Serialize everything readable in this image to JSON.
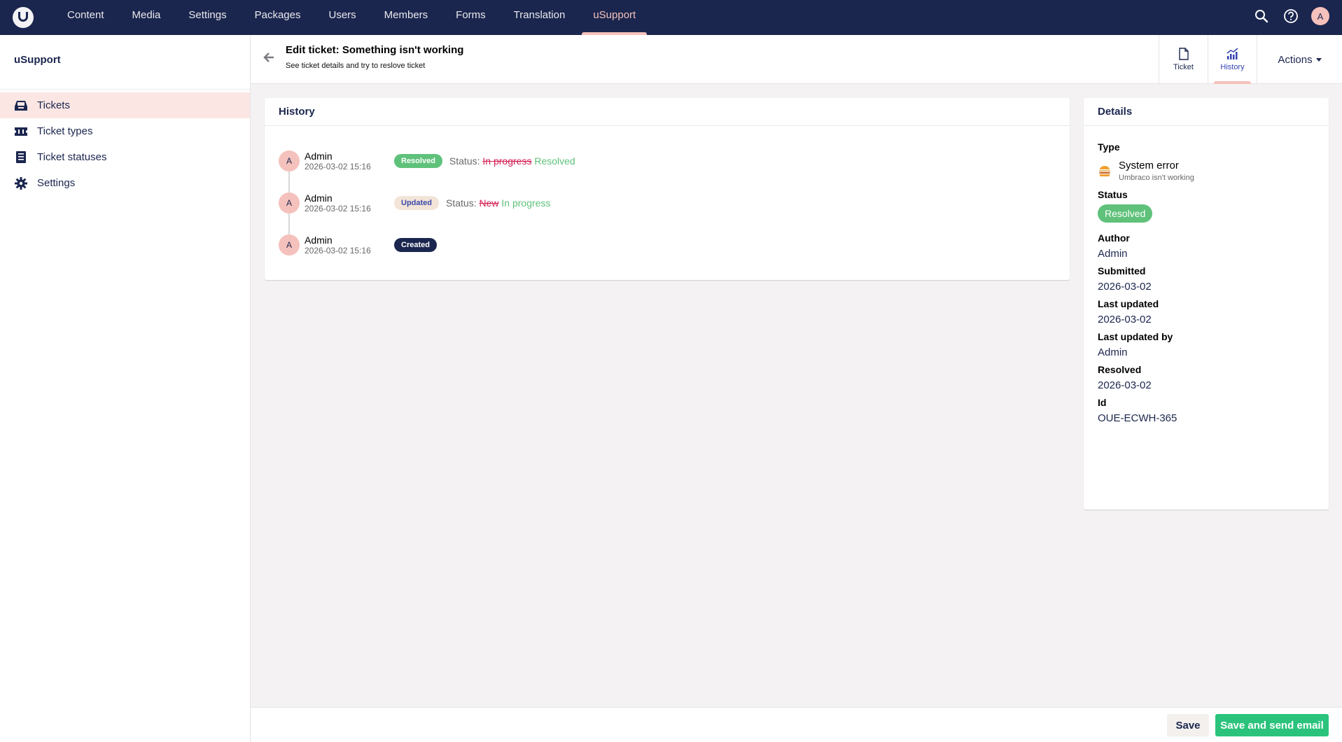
{
  "nav": {
    "items": [
      "Content",
      "Media",
      "Settings",
      "Packages",
      "Users",
      "Members",
      "Forms",
      "Translation",
      "uSupport"
    ],
    "active": "uSupport",
    "user_initial": "A"
  },
  "sidebar": {
    "title": "uSupport",
    "items": [
      {
        "label": "Tickets",
        "icon": "inbox-icon",
        "active": true
      },
      {
        "label": "Ticket types",
        "icon": "ticket-icon"
      },
      {
        "label": "Ticket statuses",
        "icon": "checklist-icon"
      },
      {
        "label": "Settings",
        "icon": "gear-icon"
      }
    ]
  },
  "header": {
    "title": "Edit ticket: Something isn't working",
    "subtitle": "See ticket details and try to reslove ticket",
    "tabs": [
      "Ticket",
      "History"
    ],
    "active_tab": "History",
    "actions_label": "Actions"
  },
  "history": {
    "title": "History",
    "entries": [
      {
        "initial": "A",
        "name": "Admin",
        "date": "2026-03-02 15:16",
        "badge": "Resolved",
        "prefix": "Status:",
        "old": "In progress",
        "new": "Resolved"
      },
      {
        "initial": "A",
        "name": "Admin",
        "date": "2026-03-02 15:16",
        "badge": "Updated",
        "prefix": "Status:",
        "old": "New",
        "new": "In progress"
      },
      {
        "initial": "A",
        "name": "Admin",
        "date": "2026-03-02 15:16",
        "badge": "Created"
      }
    ]
  },
  "details": {
    "title": "Details",
    "type_label": "Type",
    "type_name": "System error",
    "type_description": "Umbraco isn't working",
    "status_label": "Status",
    "status_value": "Resolved",
    "author_label": "Author",
    "author_value": "Admin",
    "submitted_label": "Submitted",
    "submitted_value": "2026-03-02",
    "last_updated_label": "Last updated",
    "last_updated_value": "2026-03-02",
    "last_updated_by_label": "Last updated by",
    "last_updated_by_value": "Admin",
    "resolved_label": "Resolved",
    "resolved_value": "2026-03-02",
    "id_label": "Id",
    "id_value": "OUE-ECWH-365"
  },
  "footer": {
    "save_label": "Save",
    "save_send_label": "Save and send email"
  },
  "colors": {
    "nav_bg": "#1b264f",
    "accent_pink": "#f5c1bc",
    "success": "#2bc37c",
    "danger": "#d42054"
  }
}
